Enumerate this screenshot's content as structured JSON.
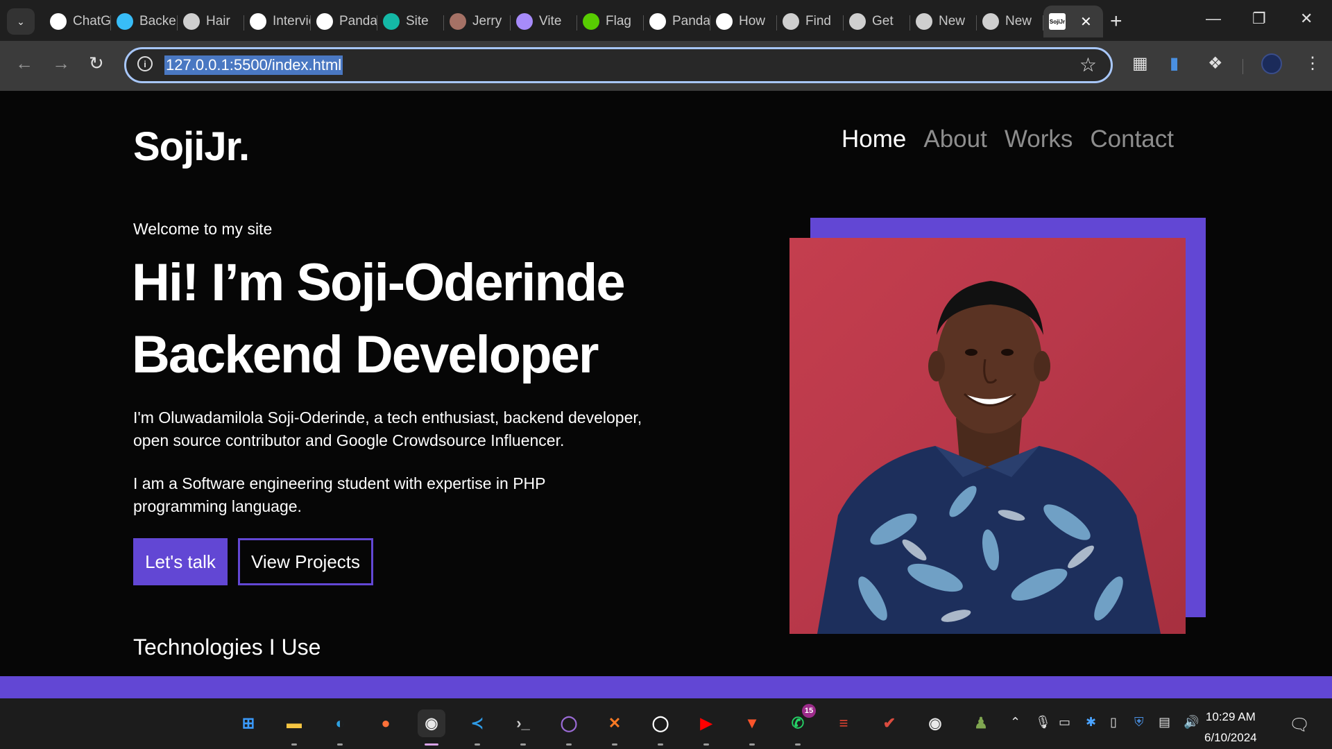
{
  "browser": {
    "tabs": [
      {
        "label": "ChatGPT",
        "icon": "openai-icon",
        "color": "#ffffff"
      },
      {
        "label": "Backend",
        "icon": "tailwind-icon",
        "color": "#38bdf8"
      },
      {
        "label": "Hair",
        "icon": "globe-icon",
        "color": "#cfcfcf"
      },
      {
        "label": "Interview",
        "icon": "medium-m-icon",
        "color": "#ffffff"
      },
      {
        "label": "Panda",
        "icon": "panda-icon",
        "color": "#ffffff"
      },
      {
        "label": "Site",
        "icon": "diamond-icon",
        "color": "#14b8a6"
      },
      {
        "label": "Jerry",
        "icon": "photo-icon",
        "color": "#a57165"
      },
      {
        "label": "Vite",
        "icon": "vite-icon",
        "color": "#a78bfa"
      },
      {
        "label": "Flag",
        "icon": "duolingo-icon",
        "color": "#58cc02"
      },
      {
        "label": "Panda",
        "icon": "panda-icon",
        "color": "#ffffff"
      },
      {
        "label": "How",
        "icon": "medium-icon",
        "color": "#ffffff"
      },
      {
        "label": "Find",
        "icon": "globe-icon",
        "color": "#cfcfcf"
      },
      {
        "label": "Get",
        "icon": "globe-icon",
        "color": "#cfcfcf"
      },
      {
        "label": "New",
        "icon": "chrome-icon",
        "color": "#cfcfcf"
      },
      {
        "label": "New",
        "icon": "chrome-icon",
        "color": "#cfcfcf"
      }
    ],
    "active_tab": {
      "favicon_text": "SojiJr",
      "close": "✕"
    },
    "new_tab": "+",
    "url": "127.0.0.1:5500/index.html",
    "window_controls": {
      "minimize": "—",
      "restore": "❐",
      "close": "✕"
    }
  },
  "site": {
    "logo": "SojiJr.",
    "nav": [
      "Home",
      "About",
      "Works",
      "Contact"
    ],
    "welcome": "Welcome to my site",
    "headline_1": "Hi! I’m Soji-Oderinde",
    "headline_2": "Backend Developer",
    "intro": "I'm Oluwadamilola Soji-Oderinde, a tech enthusiast, backend developer, open source contributor and Google Crowdsource Influencer.",
    "student": "I am a Software engineering student with expertise in PHP programming language.",
    "cta_primary": "Let's talk",
    "cta_secondary": "View Projects",
    "tech_heading": "Technologies I Use",
    "accent_color": "#6247d4"
  },
  "taskbar": {
    "apps": [
      {
        "name": "windows-start-icon",
        "glyph": "⊞",
        "color": "#3b9cff"
      },
      {
        "name": "file-explorer-icon",
        "glyph": "▬",
        "color": "#f5c542"
      },
      {
        "name": "edge-icon",
        "glyph": "◐",
        "color": "#2ea0e0"
      },
      {
        "name": "firefox-icon",
        "glyph": "●",
        "color": "#ff7139"
      },
      {
        "name": "chrome-icon",
        "glyph": "◉",
        "color": "#e8e8e8"
      },
      {
        "name": "vscode-icon",
        "glyph": "≺",
        "color": "#2f9be6"
      },
      {
        "name": "terminal-icon",
        "glyph": "›_",
        "color": "#cccccc"
      },
      {
        "name": "github-desktop-icon",
        "glyph": "◯",
        "color": "#9b6bd6"
      },
      {
        "name": "xampp-icon",
        "glyph": "✕",
        "color": "#fb7a24"
      },
      {
        "name": "github-icon",
        "glyph": "◯",
        "color": "#ffffff"
      },
      {
        "name": "youtube-icon",
        "glyph": "▶",
        "color": "#ff0000"
      },
      {
        "name": "brave-icon",
        "glyph": "▼",
        "color": "#fb542b"
      },
      {
        "name": "whatsapp-icon",
        "glyph": "✆",
        "color": "#25d366"
      },
      {
        "name": "todoist-icon",
        "glyph": "≡",
        "color": "#e44332"
      },
      {
        "name": "tasks-icon",
        "glyph": "✔",
        "color": "#db4c3f"
      },
      {
        "name": "chrome-alt-icon",
        "glyph": "◉",
        "color": "#e8e8e8"
      },
      {
        "name": "chess-icon",
        "glyph": "♟",
        "color": "#7fa650"
      }
    ],
    "whatsapp_badge": "15",
    "time": "10:29 AM",
    "date": "6/10/2024"
  }
}
